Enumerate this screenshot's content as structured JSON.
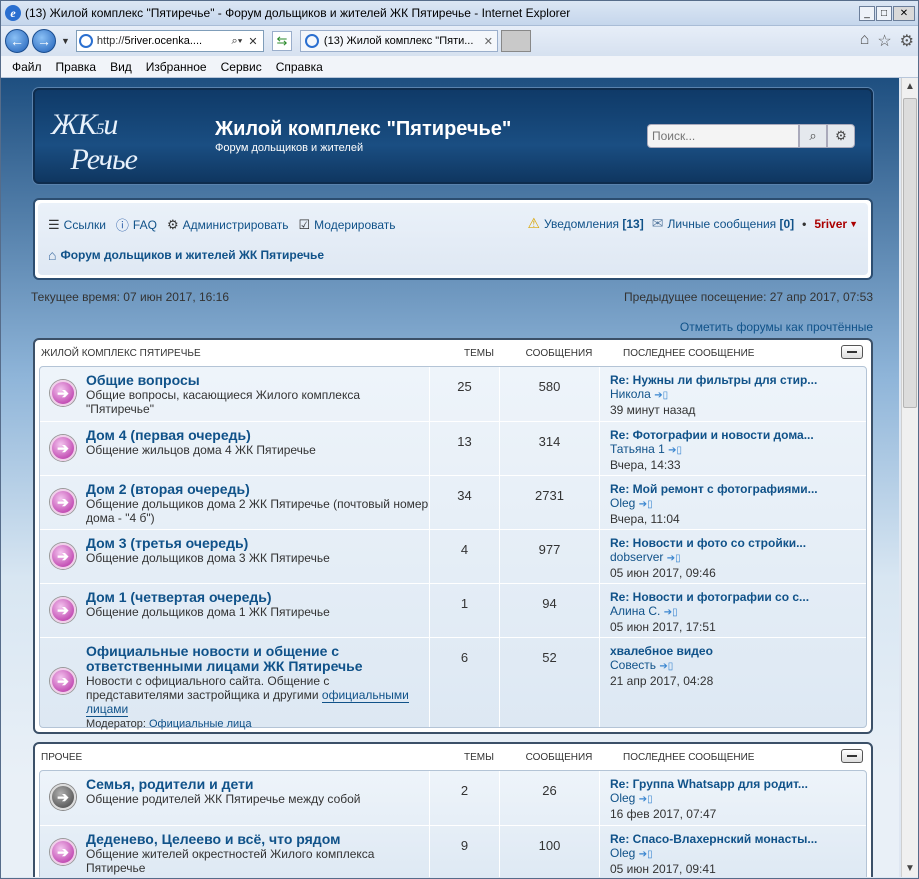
{
  "browser": {
    "title": "(13) Жилой комплекс \"Пятиречье\" - Форум дольщиков и жителей ЖК Пятиречье - Internet Explorer",
    "address_prefix": "http://",
    "address_host": "5river.ocenka....",
    "tab_label": "(13) Жилой комплекс \"Пяти...",
    "menu": [
      "Файл",
      "Правка",
      "Вид",
      "Избранное",
      "Сервис",
      "Справка"
    ]
  },
  "site": {
    "logo_text": "ЖК5иРечье",
    "title": "Жилой комплекс \"Пятиречье\"",
    "description": "Форум дольщиков и жителей",
    "search_placeholder": "Поиск..."
  },
  "nav": {
    "links": "Ссылки",
    "faq": "FAQ",
    "admin": "Администрировать",
    "moderate": "Модерировать",
    "notifications": "Уведомления",
    "notifications_count": "[13]",
    "pm": "Личные сообщения",
    "pm_count": "[0]",
    "user": "5river",
    "breadcrumb": "Форум дольщиков и жителей ЖК Пятиречье"
  },
  "time": {
    "current": "Текущее время: 07 июн 2017, 16:16",
    "previous": "Предыдущее посещение: 27 апр 2017, 07:53",
    "mark_read": "Отметить форумы как прочтённые"
  },
  "categories": [
    {
      "name": "ЖИЛОЙ КОМПЛЕКС ПЯТИРЕЧЬЕ",
      "col_topics": "ТЕМЫ",
      "col_posts": "СООБЩЕНИЯ",
      "col_last": "ПОСЛЕДНЕЕ СООБЩЕНИЕ",
      "forums": [
        {
          "title": "Общие вопросы",
          "desc": "Общие вопросы, касающиеся Жилого комплекса \"Пятиречье\"",
          "topics": "25",
          "posts": "580",
          "last_title": "Re: Нужны ли фильтры для стир...",
          "last_author": "Никола",
          "last_time": "39 минут назад",
          "status": "unread"
        },
        {
          "title": "Дом 4 (первая очередь)",
          "desc": "Общение жильцов дома 4 ЖК Пятиречье",
          "topics": "13",
          "posts": "314",
          "last_title": "Re: Фотографии и новости дома...",
          "last_author": "Татьяна 1",
          "last_time": "Вчера, 14:33",
          "status": "unread"
        },
        {
          "title": "Дом 2 (вторая очередь)",
          "desc": "Общение дольщиков дома 2 ЖК Пятиречье (почтовый номер дома - \"4 б\")",
          "topics": "34",
          "posts": "2731",
          "last_title": "Re: Мой ремонт с фотографиями...",
          "last_author": "Oleg",
          "last_time": "Вчера, 11:04",
          "status": "unread"
        },
        {
          "title": "Дом 3 (третья очередь)",
          "desc": "Общение дольщиков дома 3 ЖК Пятиречье",
          "topics": "4",
          "posts": "977",
          "last_title": "Re: Новости и фото со стройки...",
          "last_author": "dobserver",
          "last_time": "05 июн 2017, 09:46",
          "status": "unread"
        },
        {
          "title": "Дом 1 (четвертая очередь)",
          "desc": "Общение дольщиков дома 1 ЖК Пятиречье",
          "topics": "1",
          "posts": "94",
          "last_title": "Re: Новости и фотографии со с...",
          "last_author": "Алина С.",
          "last_time": "05 июн 2017, 17:51",
          "status": "unread"
        },
        {
          "title": "Официальные новости и общение с ответственными лицами ЖК Пятиречье",
          "desc": "Новости с официального сайта. Общение с представителями застройщика и другими",
          "desc_link": "официальными лицами",
          "moderator_label": "Модератор:",
          "moderator": "Официальные лица",
          "topics": "6",
          "posts": "52",
          "last_title": "хвалебное видео",
          "last_author": "Совесть",
          "last_time": "21 апр 2017, 04:28",
          "status": "unread"
        }
      ]
    },
    {
      "name": "ПРОЧЕЕ",
      "col_topics": "ТЕМЫ",
      "col_posts": "СООБЩЕНИЯ",
      "col_last": "ПОСЛЕДНЕЕ СООБЩЕНИЕ",
      "forums": [
        {
          "title": "Семья, родители и дети",
          "desc": "Общение родителей ЖК Пятиречье между собой",
          "topics": "2",
          "posts": "26",
          "last_title": "Re: Группа Whatsapp для родит...",
          "last_author": "Oleg",
          "last_time": "16 фев 2017, 07:47",
          "status": "read"
        },
        {
          "title": "Деденево, Целеево и всё, что рядом",
          "desc": "Общение жителей окрестностей Жилого комплекса Пятиречье",
          "topics": "9",
          "posts": "100",
          "last_title": "Re: Спасо-Влахернский монасты...",
          "last_author": "Oleg",
          "last_time": "05 июн 2017, 09:41",
          "status": "unread"
        }
      ]
    }
  ]
}
